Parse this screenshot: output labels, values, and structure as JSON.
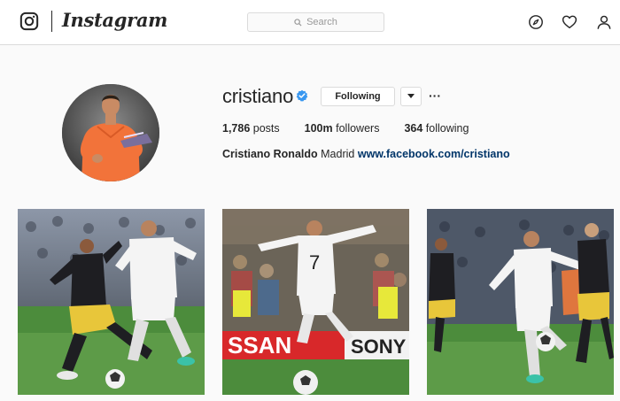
{
  "nav": {
    "brand": "Instagram",
    "search_placeholder": "Search",
    "icons": [
      "instagram-glyph-icon",
      "compass-icon",
      "heart-icon",
      "person-icon"
    ]
  },
  "profile": {
    "username": "cristiano",
    "verified": true,
    "follow_label": "Following",
    "stats": [
      {
        "value": "1,786",
        "label": "posts"
      },
      {
        "value": "100m",
        "label": "followers"
      },
      {
        "value": "364",
        "label": "following"
      }
    ],
    "full_name": "Cristiano Ronaldo",
    "bio": "Madrid",
    "website": "www.facebook.com/cristiano"
  },
  "posts": [
    {
      "alt": "Ronaldo in white kit dribbling past a defender in dark kit"
    },
    {
      "alt": "Ronaldo celebrating with arms spread, number 7 on back"
    },
    {
      "alt": "Ronaldo striking the ball in front of the crowd"
    }
  ],
  "post_banner_text": [
    "SSAN",
    "SONY"
  ],
  "kit_numbers": [
    "7"
  ],
  "colors": {
    "link": "#003569",
    "verified_blue": "#3897f0",
    "border": "#dbdbdb",
    "background": "#fafafa"
  }
}
